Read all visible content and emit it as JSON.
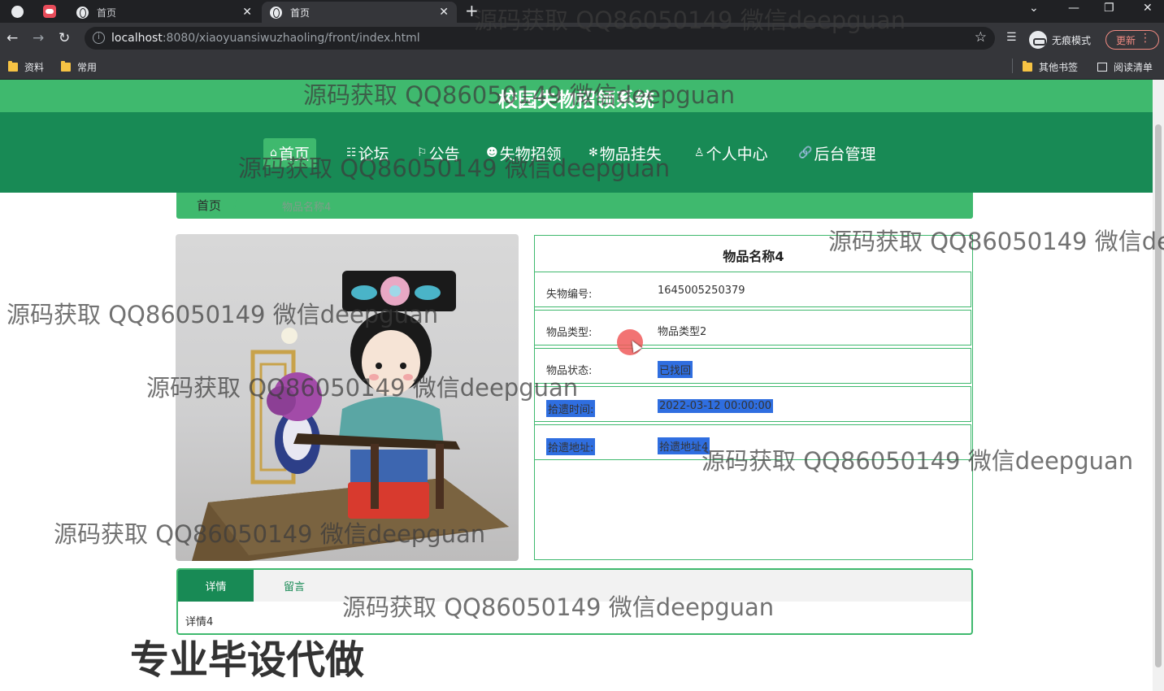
{
  "browser": {
    "tabs": [
      {
        "title": "首页",
        "active": false
      },
      {
        "title": "首页",
        "active": true
      }
    ],
    "url_host": "localhost",
    "url_rest": ":8080/xiaoyuansiwuzhaoling/front/index.html",
    "incognito_label": "无痕模式",
    "update_label": "更新",
    "bookmarks": [
      "资料",
      "常用"
    ],
    "bookmarks_right": [
      "其他书签",
      "阅读清单"
    ]
  },
  "site": {
    "title": "校园失物招领系统",
    "nav": [
      {
        "label": "首页",
        "icon": "⌂",
        "active": true
      },
      {
        "label": "论坛",
        "icon": "☷",
        "active": false
      },
      {
        "label": "公告",
        "icon": "⚐",
        "active": false
      },
      {
        "label": "失物招领",
        "icon": "☻",
        "active": false
      },
      {
        "label": "物品挂失",
        "icon": "✻",
        "active": false
      },
      {
        "label": "个人中心",
        "icon": "♙",
        "active": false
      },
      {
        "label": "后台管理",
        "icon": "🔗",
        "active": false
      }
    ]
  },
  "breadcrumb": {
    "home": "首页",
    "separator": "/",
    "current": "物品名称4"
  },
  "detail": {
    "title": "物品名称4",
    "rows": [
      {
        "label": "失物编号:",
        "value": "1645005250379",
        "selected": false
      },
      {
        "label": "物品类型:",
        "value": "物品类型2",
        "selected": false
      },
      {
        "label": "物品状态:",
        "value": "已找回",
        "selected": false,
        "value_selected": true
      },
      {
        "label": "拾遗时间:",
        "value": "2022-03-12 00:00:00",
        "selected": true,
        "value_selected": true
      },
      {
        "label": "拾遗地址:",
        "value": "拾遗地址4",
        "selected": true,
        "value_selected": true
      }
    ]
  },
  "tabs_panel": {
    "tabs": [
      "详情",
      "留言"
    ],
    "active": "详情",
    "content": "详情4"
  },
  "overlay": {
    "watermark": "源码获取 QQ86050149 微信deepguan",
    "promo": "专业毕设代做"
  },
  "colors": {
    "brand_light": "#3fb96e",
    "brand_dark": "#188a55",
    "selection": "#2f6ee0"
  }
}
